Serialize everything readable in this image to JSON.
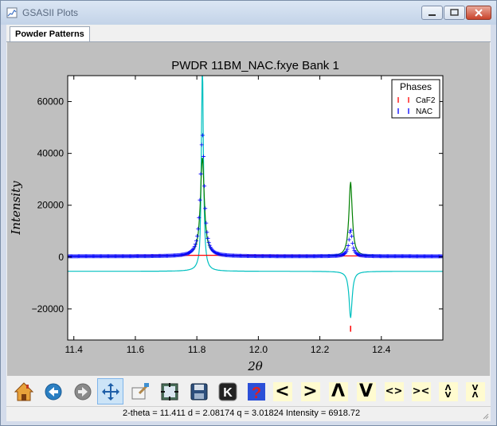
{
  "window": {
    "title": "GSASII Plots",
    "min_icon": "minimize-icon",
    "max_icon": "maximize-icon",
    "close_icon": "close-icon"
  },
  "tabs": [
    {
      "label": "Powder Patterns"
    }
  ],
  "chart_data": {
    "type": "line",
    "title": "PWDR 11BM_NAC.fxye Bank 1",
    "xlabel": "2θ",
    "ylabel": "Intensity",
    "xlim": [
      11.38,
      12.6
    ],
    "ylim": [
      -32000,
      70000
    ],
    "xticks": [
      11.4,
      11.6,
      11.8,
      12.0,
      12.2,
      12.4
    ],
    "xtick_labels": [
      "11.4",
      "11.6",
      "11.8",
      "12.0",
      "12.2",
      "12.4"
    ],
    "yticks": [
      -20000,
      0,
      20000,
      40000,
      60000
    ],
    "ytick_labels": [
      "−20000",
      "0",
      "20000",
      "40000",
      "60000"
    ],
    "grid": false,
    "legend": {
      "title": "Phases",
      "placement": "top-right",
      "entries": [
        {
          "name": "CaF2",
          "color": "#ff0000"
        },
        {
          "name": "NAC",
          "color": "#0000ff"
        }
      ]
    },
    "series": [
      {
        "role": "observed",
        "color": "#0000ff",
        "marker": "+",
        "baseline": 300,
        "peaks": [
          {
            "x": 11.818,
            "height": 47000,
            "width": 0.0075
          },
          {
            "x": 12.3,
            "height": 10200,
            "width": 0.0065
          }
        ]
      },
      {
        "role": "calculated",
        "color": "#008000",
        "baseline": 300,
        "peaks": [
          {
            "x": 11.818,
            "height": 38200,
            "width": 0.0075
          },
          {
            "x": 12.3,
            "height": 28700,
            "width": 0.0065
          }
        ]
      },
      {
        "role": "background",
        "color": "#ff0000",
        "x": [
          11.38,
          11.8,
          11.85,
          12.6
        ],
        "y": [
          300,
          700,
          700,
          300
        ]
      },
      {
        "role": "difference",
        "color": "#00c0c0",
        "baseline": -5500,
        "peaks": [
          {
            "x": 11.818,
            "height": 80000,
            "width": 0.004
          },
          {
            "x": 11.81,
            "height": -3500,
            "width": 0.004
          },
          {
            "x": 12.3,
            "height": -18000,
            "width": 0.006
          }
        ]
      }
    ],
    "reflections": [
      {
        "phase": "CaF2",
        "color": "#ff0000",
        "x": [
          12.3
        ]
      }
    ]
  },
  "toolbar": {
    "buttons": [
      {
        "name": "home-button",
        "icon": "home-icon"
      },
      {
        "name": "back-button",
        "icon": "back-arrow-icon"
      },
      {
        "name": "forward-button",
        "icon": "forward-arrow-icon"
      },
      {
        "name": "pan-button",
        "icon": "pan-icon",
        "active": true
      },
      {
        "name": "zoom-button",
        "icon": "zoom-icon"
      },
      {
        "name": "configure-subplots-button",
        "icon": "subplots-icon"
      },
      {
        "name": "save-button",
        "icon": "save-icon"
      },
      {
        "name": "key-button",
        "icon": "key-icon",
        "label": "K"
      },
      {
        "name": "help-button",
        "icon": "help-icon",
        "label": "?"
      },
      {
        "name": "shift-left-button",
        "label": "<"
      },
      {
        "name": "shift-right-button",
        "label": ">"
      },
      {
        "name": "shift-up-button",
        "label": "Λ"
      },
      {
        "name": "shift-down-button",
        "label": "V"
      },
      {
        "name": "expand-x-button",
        "label": "<>"
      },
      {
        "name": "contract-x-button",
        "label": "><"
      },
      {
        "name": "expand-y-button",
        "label": "Λ\nV"
      },
      {
        "name": "contract-y-button",
        "label": "V\nΛ"
      }
    ]
  },
  "status": {
    "label_2theta": "2-theta =",
    "value_2theta": "11.411",
    "label_d": "d =",
    "value_d": "2.08174",
    "label_q": "q =",
    "value_q": "3.01824",
    "label_intensity": "Intensity =",
    "value_intensity": "6918.72"
  }
}
